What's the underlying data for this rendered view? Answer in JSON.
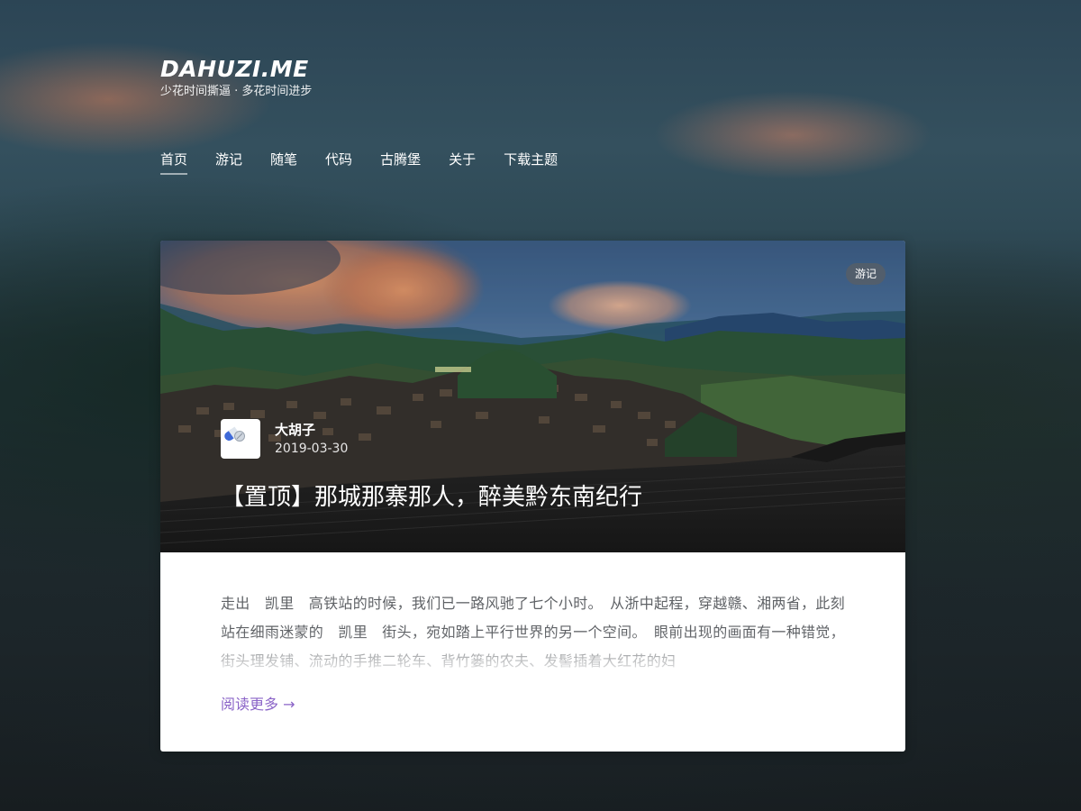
{
  "site": {
    "logo": "DAHUZI.ME",
    "tagline": "少花时间撕逼 · 多花时间进步"
  },
  "nav": {
    "items": [
      {
        "label": "首页",
        "active": true
      },
      {
        "label": "游记",
        "active": false
      },
      {
        "label": "随笔",
        "active": false
      },
      {
        "label": "代码",
        "active": false
      },
      {
        "label": "古腾堡",
        "active": false
      },
      {
        "label": "关于",
        "active": false
      },
      {
        "label": "下载主题",
        "active": false
      }
    ]
  },
  "post": {
    "category": "游记",
    "author": "大胡子",
    "date": "2019-03-30",
    "title": "【置顶】那城那寨那人，醉美黔东南纪行",
    "excerpt": "走出　凯里　高铁站的时候，我们已一路风驰了七个小时。　从浙中起程，穿越赣、湘两省，此刻站在细雨迷蒙的　凯里　街头，宛如踏上平行世界的另一个空间。　眼前出现的画面有一种错觉，街头理发铺、流动的手推二轮车、背竹篓的农夫、发髻插着大红花的妇",
    "read_more": "阅读更多 →"
  },
  "icons": {
    "avatar": "pill-icon"
  },
  "colors": {
    "accent": "#8a63c7",
    "text": "#5f6266"
  }
}
